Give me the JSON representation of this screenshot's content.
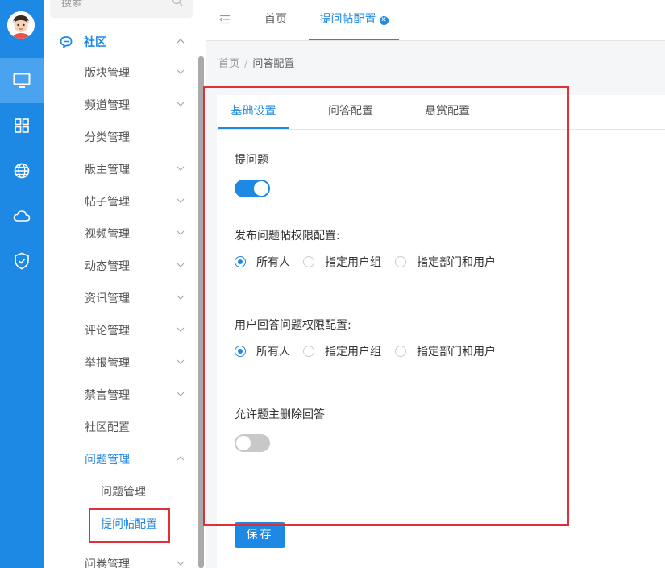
{
  "sidebar": {
    "search_placeholder": "搜索",
    "group_label": "社区",
    "items": [
      {
        "label": "版块管理"
      },
      {
        "label": "频道管理"
      },
      {
        "label": "分类管理"
      },
      {
        "label": "版主管理"
      },
      {
        "label": "帖子管理"
      },
      {
        "label": "视频管理"
      },
      {
        "label": "动态管理"
      },
      {
        "label": "资讯管理"
      },
      {
        "label": "评论管理"
      },
      {
        "label": "举报管理"
      },
      {
        "label": "禁言管理"
      },
      {
        "label": "社区配置"
      },
      {
        "label": "问题管理"
      }
    ],
    "sub_items": [
      {
        "label": "问题管理"
      },
      {
        "label": "提问帖配置"
      }
    ],
    "last_item_label": "问卷管理"
  },
  "rail": {
    "icons": [
      "monitor-icon",
      "grid-icon",
      "globe-icon",
      "cloud-icon",
      "shield-icon"
    ]
  },
  "topbar": {
    "tabs": [
      {
        "label": "首页"
      },
      {
        "label": "提问帖配置"
      }
    ]
  },
  "breadcrumb": {
    "home": "首页",
    "separator": "/",
    "current": "问答配置"
  },
  "inner_tabs": [
    {
      "label": "基础设置"
    },
    {
      "label": "问答配置"
    },
    {
      "label": "悬赏配置"
    }
  ],
  "form": {
    "ask_question": {
      "label": "提问题",
      "enabled": true
    },
    "publish_permission": {
      "label": "发布问题帖权限配置:",
      "options": [
        "所有人",
        "指定用户组",
        "指定部门和用户"
      ],
      "selected": "所有人"
    },
    "answer_permission": {
      "label": "用户回答问题权限配置:",
      "options": [
        "所有人",
        "指定用户组",
        "指定部门和用户"
      ],
      "selected": "所有人"
    },
    "moderator_delete": {
      "label": "允许题主删除回答",
      "enabled": false
    },
    "save_label": "保存"
  },
  "colors": {
    "primary": "#1e88e5",
    "highlight": "#e02f36"
  }
}
